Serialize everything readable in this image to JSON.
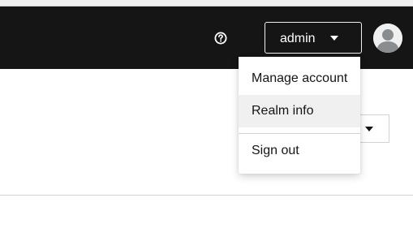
{
  "masthead": {
    "help_icon": "question-circle-icon",
    "user_toggle": {
      "label": "admin",
      "caret_icon": "caret-down-icon"
    },
    "avatar_icon": "user-avatar-icon",
    "background_color": "#151515"
  },
  "user_menu": {
    "items": [
      {
        "label": "Manage account",
        "hovered": false
      },
      {
        "label": "Realm info",
        "hovered": true
      }
    ],
    "footer_items": [
      {
        "label": "Sign out"
      }
    ],
    "hover_color": "#f0f0f0"
  },
  "page": {
    "dropdown_caret_icon": "caret-down-icon"
  }
}
